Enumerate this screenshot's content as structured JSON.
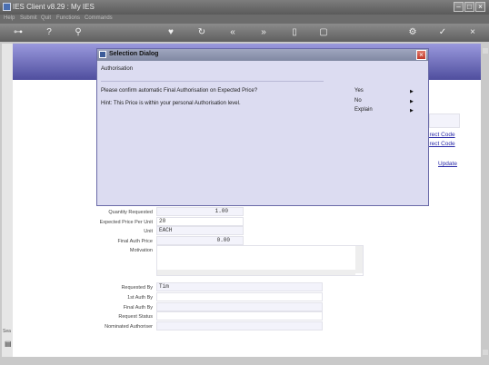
{
  "window": {
    "title": "IES Client v8.29 : My IES"
  },
  "menu": {
    "items": [
      "Help",
      "Submit",
      "Quit",
      "Functions",
      "Commands"
    ]
  },
  "form": {
    "links": [
      "irect Code",
      "irect Code",
      "Update"
    ],
    "labels": {
      "quantity": "Quantity Requested",
      "expected_price": "Expected Price Per Unit",
      "unit": "Unit",
      "final_auth_price": "Final Auth Price",
      "motivation": "Motivation",
      "requested_by": "Requested By",
      "first_auth_by": "1st Auth By",
      "final_auth_by": "Final Auth By",
      "request_status": "Request Status",
      "nominated_authoriser": "Nominated Authoriser"
    },
    "values": {
      "quantity": "1.00",
      "expected_price": "20",
      "unit": "EACH",
      "final_auth_price": "0.00",
      "requested_by": "Tim"
    }
  },
  "dialog": {
    "title": "Selection Dialog",
    "subtitle": "Authorisation",
    "message": "Please confirm automatic Final Authorisation on Expected Price?",
    "hint": "Hint: This Price is within your personal Authorisation level.",
    "options": [
      "Yes",
      "No",
      "Explain"
    ]
  },
  "left_strip": {
    "label": "Sea"
  }
}
